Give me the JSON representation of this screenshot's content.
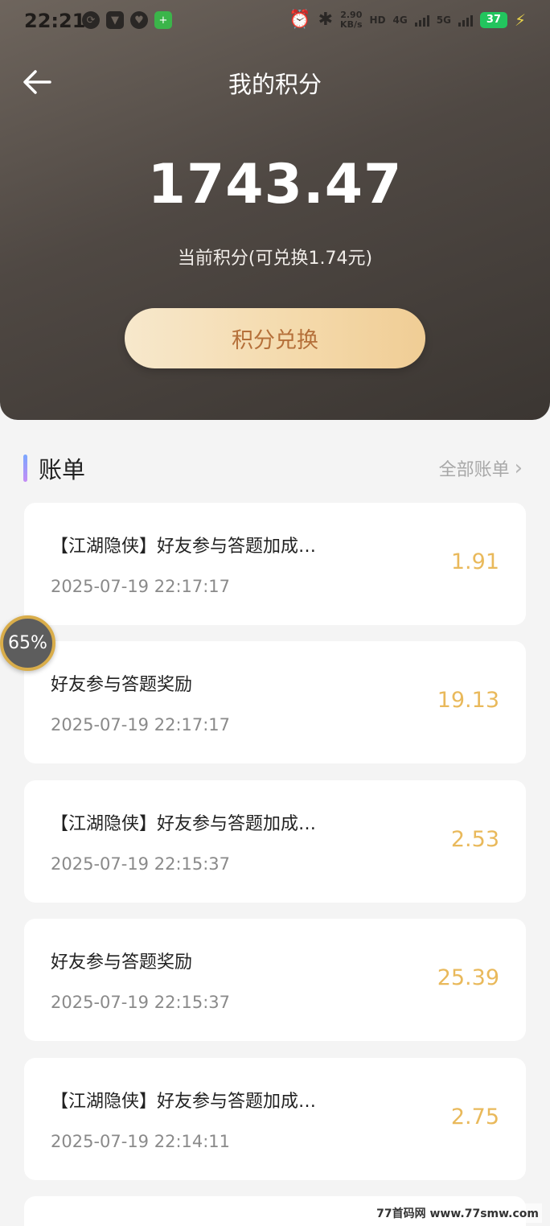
{
  "status_bar": {
    "time": "22:21",
    "net_speed_value": "2.90",
    "net_speed_unit": "KB/s",
    "hd_label": "HD",
    "signal_4g": "4G",
    "signal_5g": "5G",
    "battery": "37"
  },
  "header": {
    "title": "我的积分",
    "points": "1743.47",
    "points_sub": "当前积分(可兑换1.74元)",
    "exchange_label": "积分兑换"
  },
  "section": {
    "title": "账单",
    "all_label": "全部账单"
  },
  "bills": [
    {
      "title": "【江湖隐侠】好友参与答题加成…",
      "time": "2025-07-19 22:17:17",
      "amount": "1.91"
    },
    {
      "title": "好友参与答题奖励",
      "time": "2025-07-19 22:17:17",
      "amount": "19.13"
    },
    {
      "title": "【江湖隐侠】好友参与答题加成…",
      "time": "2025-07-19 22:15:37",
      "amount": "2.53"
    },
    {
      "title": "好友参与答题奖励",
      "time": "2025-07-19 22:15:37",
      "amount": "25.39"
    },
    {
      "title": "【江湖隐侠】好友参与答题加成…",
      "time": "2025-07-19 22:14:11",
      "amount": "2.75"
    }
  ],
  "float_badge": {
    "label": "65%",
    "progress_percent": 65
  },
  "watermark": "77首码网 www.77smw.com",
  "colors": {
    "header_bg": "#4f4843",
    "exchange_btn": "#f4d9aa",
    "exchange_text": "#b5703a",
    "amount": "#e9b95b"
  }
}
